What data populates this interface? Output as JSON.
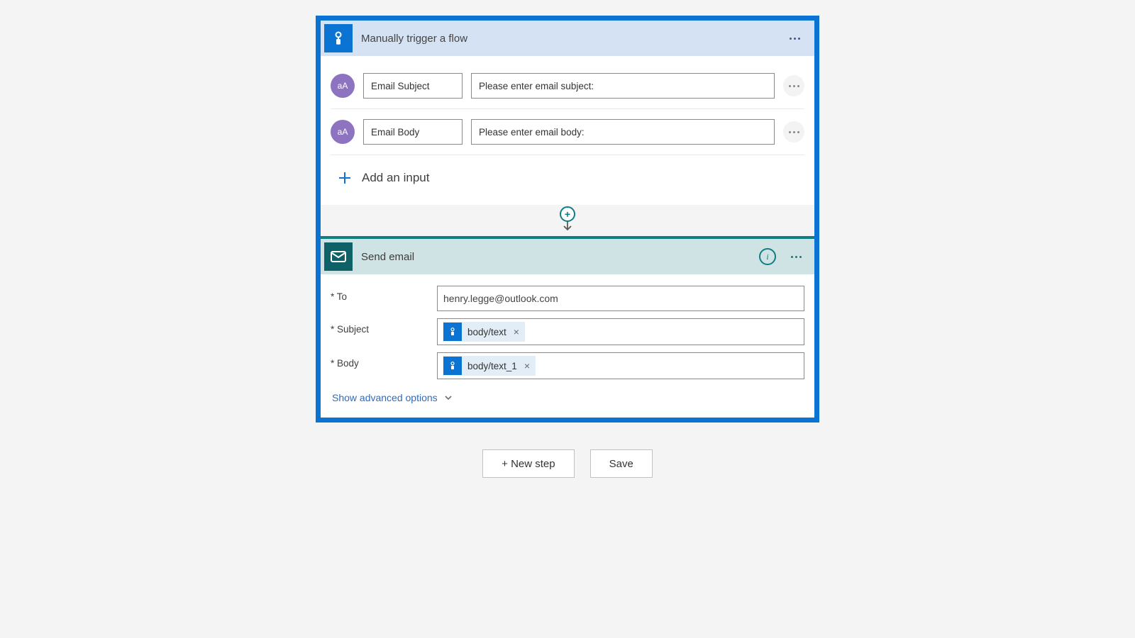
{
  "trigger": {
    "title": "Manually trigger a flow",
    "inputs": [
      {
        "badge": "aA",
        "name": "Email Subject",
        "prompt": "Please enter email subject:"
      },
      {
        "badge": "aA",
        "name": "Email Body",
        "prompt": "Please enter email body:"
      }
    ],
    "add_input_label": "Add an input"
  },
  "action": {
    "title": "Send email",
    "fields": {
      "to": {
        "label": "* To",
        "value": "henry.legge@outlook.com"
      },
      "subject": {
        "label": "* Subject",
        "token": "body/text"
      },
      "body": {
        "label": "* Body",
        "token": "body/text_1"
      }
    },
    "advanced_label": "Show advanced options"
  },
  "footer": {
    "new_step": "+ New step",
    "save": "Save"
  },
  "glyphs": {
    "plus": "+",
    "cross": "×",
    "info": "i"
  }
}
